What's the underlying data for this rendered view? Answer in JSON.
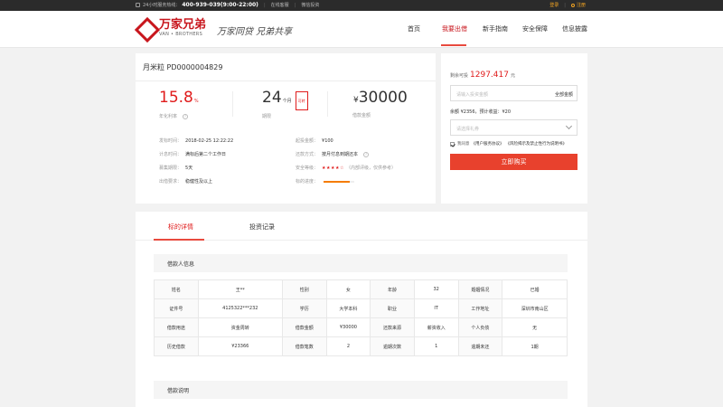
{
  "topbar": {
    "hotline_label": "24小时服务热线：",
    "hotline_number": "400-939-039(9:00-22:00)",
    "online_service": "在线客服",
    "wechat": "微信投资",
    "login": "登录",
    "register": "注册"
  },
  "header": {
    "logo_cn": "万家兄弟",
    "logo_en": "VAN • BROTHERS",
    "slogan": "万家同贷  兄弟共享",
    "nav": [
      "首页",
      "我要出借",
      "新手指南",
      "安全保障",
      "信息披露"
    ],
    "active_nav": "我要出借"
  },
  "product": {
    "title": "月米粒  PD0000004829",
    "rate": "15.8",
    "rate_unit": "%",
    "rate_label": "年化利率",
    "term": "24",
    "term_unit": "个月",
    "term_label": "期限",
    "term_tag": "可转",
    "amount": "30000",
    "amount_prefix": "¥",
    "amount_label": "借款金额",
    "details": {
      "publish_time_k": "发标时间：",
      "publish_time_v": "2018-02-25 12:22:22",
      "interest_time_k": "计息时间：",
      "interest_time_v": "满标后第二个工作日",
      "lock_period_k": "募集期限：",
      "lock_period_v": "5天",
      "requirement_k": "出借要求：",
      "requirement_v": "稳健性及以上",
      "min_amount_k": "起投金额：",
      "min_amount_v": "¥100",
      "repay_k": "还款方式：",
      "repay_v": "按月付息到期还本",
      "safety_k": "安全等级：",
      "safety_stars": "★★★★☆",
      "safety_note": "（内部评级，仅供参考）",
      "progress_k": "标的进度：",
      "progress": 0.85
    }
  },
  "purchase": {
    "available_label": "剩余可投",
    "available_amount": "1297.417",
    "available_unit": "元",
    "invest_placeholder": "请输入投资金额",
    "all_in": "全部金额",
    "balance_line": "余额 ¥2356，预计收益：¥20",
    "coupon_placeholder": "请选择礼券",
    "agree_prefix": "我同意",
    "agree_link1": "《用户服务协议》",
    "agree_link2": "《风险揭示及禁止性行为说明书》",
    "buy_button": "立即购买"
  },
  "detail_tabs": {
    "tabs": [
      "标的详情",
      "投资记录"
    ],
    "borrower_section": "借款人信息",
    "rows": [
      [
        "姓名",
        "王**",
        "性别",
        "女",
        "年龄",
        "32",
        "婚姻情况",
        "已婚"
      ],
      [
        "证件号",
        "4125322***232",
        "学历",
        "大学本科",
        "职业",
        "IT",
        "工作地址",
        "深圳市南山区"
      ],
      [
        "借款用途",
        "资金周转",
        "借款金额",
        "¥30000",
        "还款来源",
        "薪资收入",
        "个人负债",
        "无"
      ],
      [
        "历史借款",
        "¥23366",
        "借款笔数",
        "2",
        "逾期次数",
        "1",
        "逾期未还",
        "1期"
      ]
    ],
    "desc_section": "借款说明"
  },
  "colors": {
    "accent": "#e8412d",
    "brand": "#c8161d",
    "progress": "#f57c00"
  }
}
